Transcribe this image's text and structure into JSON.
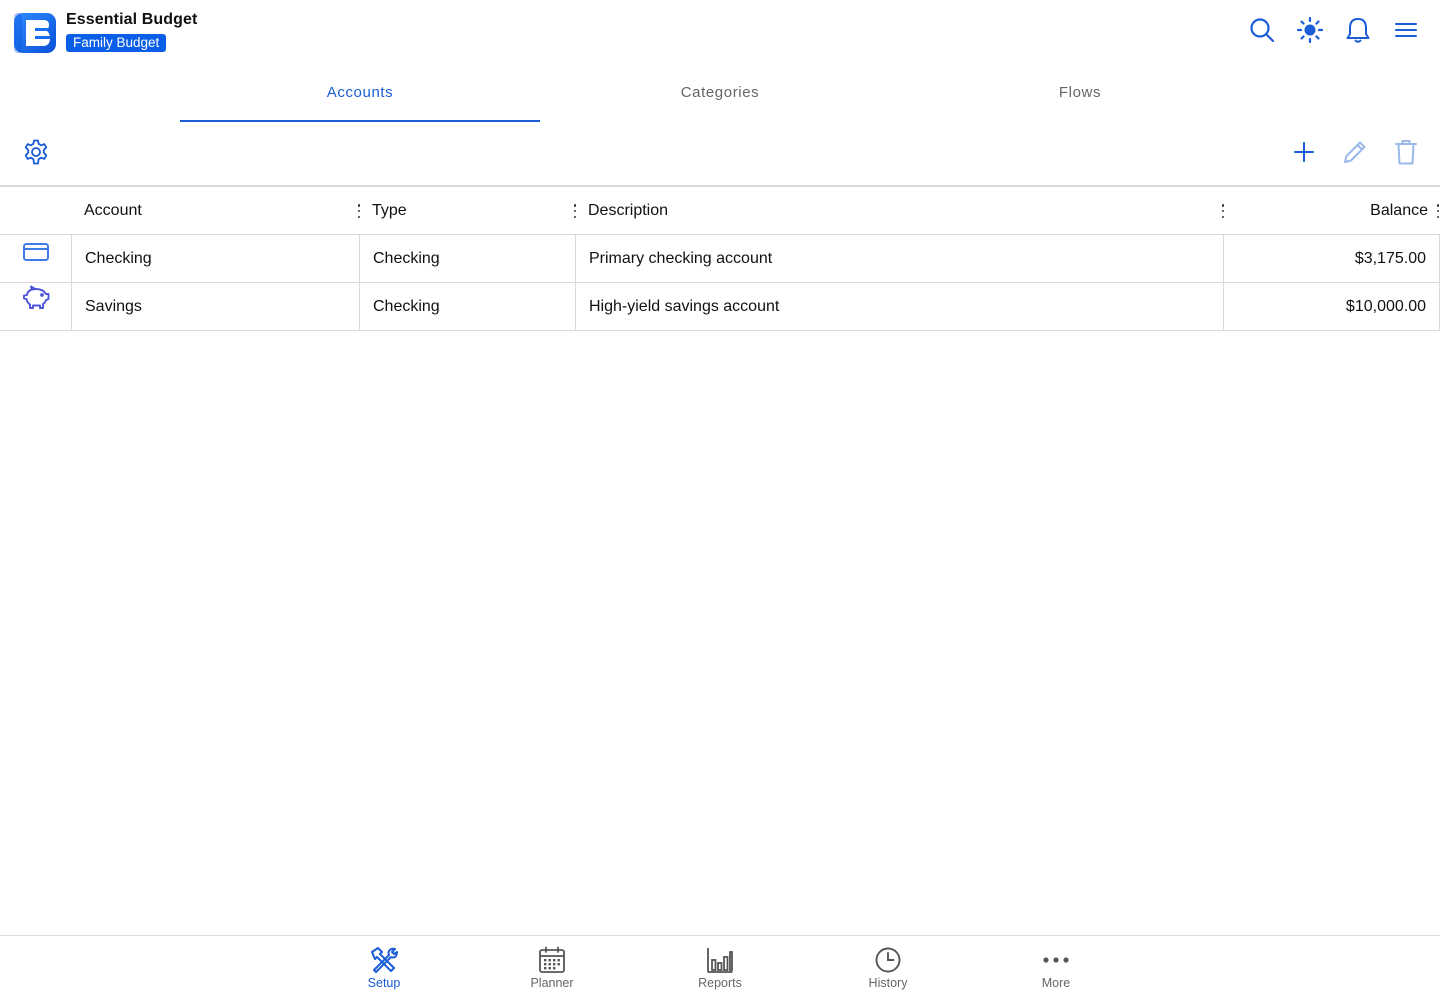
{
  "app": {
    "title": "Essential Budget",
    "budget_name": "Family Budget"
  },
  "header_icons": [
    "search-icon",
    "brightness-icon",
    "bell-icon",
    "menu-icon"
  ],
  "tabs": [
    {
      "label": "Accounts",
      "active": true
    },
    {
      "label": "Categories",
      "active": false
    },
    {
      "label": "Flows",
      "active": false
    }
  ],
  "toolbar": {
    "left_icon": "gear-icon",
    "actions": [
      "plus-icon",
      "pencil-icon",
      "trash-icon"
    ]
  },
  "table": {
    "columns": [
      "Account",
      "Type",
      "Description",
      "Balance"
    ],
    "rows": [
      {
        "icon": "credit-card-icon",
        "account": "Checking",
        "type": "Checking",
        "description": "Primary checking account",
        "balance": "$3,175.00"
      },
      {
        "icon": "piggy-bank-icon",
        "account": "Savings",
        "type": "Checking",
        "description": "High-yield savings account",
        "balance": "$10,000.00"
      }
    ]
  },
  "bottom_nav": [
    {
      "label": "Setup",
      "icon": "tools-icon",
      "active": true
    },
    {
      "label": "Planner",
      "icon": "calendar-icon",
      "active": false
    },
    {
      "label": "Reports",
      "icon": "bar-chart-icon",
      "active": false
    },
    {
      "label": "History",
      "icon": "clock-icon",
      "active": false
    },
    {
      "label": "More",
      "icon": "more-dots-icon",
      "active": false
    }
  ],
  "colors": {
    "accent": "#1a5dd6",
    "badge": "#0b5ee8",
    "muted_text": "#666666",
    "border": "#d9d9d9"
  }
}
